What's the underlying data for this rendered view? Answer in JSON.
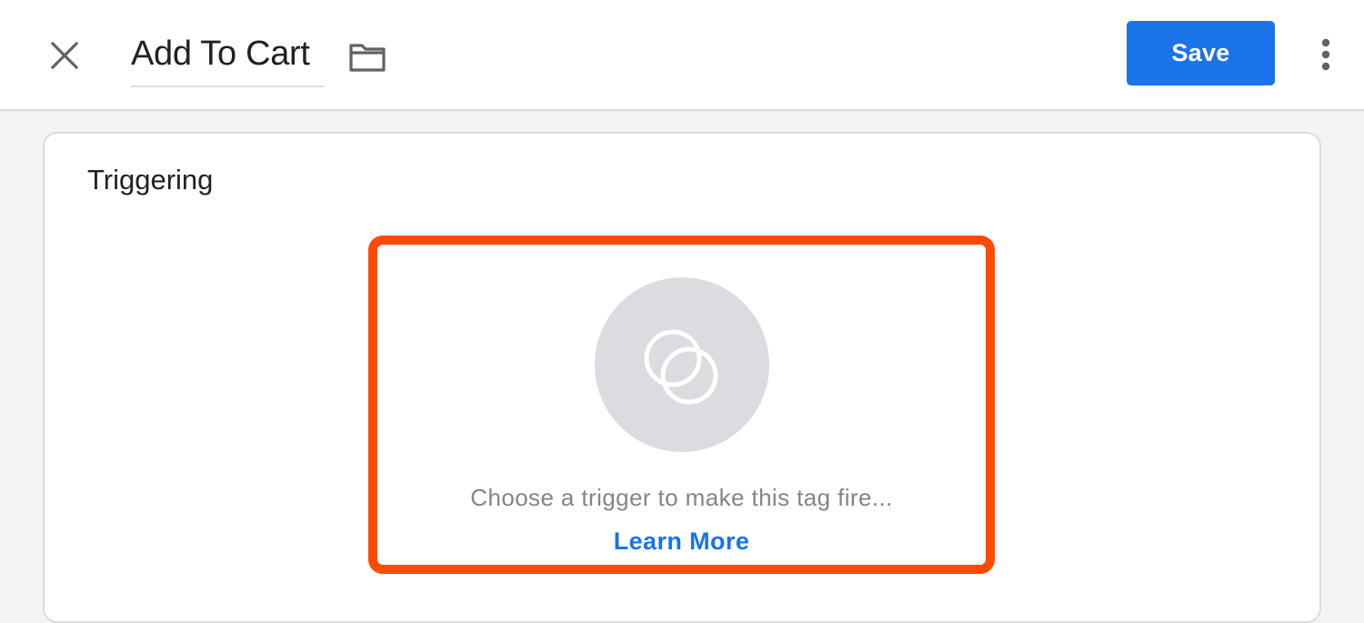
{
  "header": {
    "close_icon": "close-icon",
    "title": "Add To Cart",
    "folder_icon": "folder-icon",
    "save_label": "Save",
    "more_icon": "more-vert-icon"
  },
  "triggering": {
    "section_title": "Triggering",
    "icon": "trigger-circles-icon",
    "prompt": "Choose a trigger to make this tag fire...",
    "learn_more": "Learn More"
  },
  "colors": {
    "accent": "#1a73e8",
    "highlight": "#ff4a00",
    "background": "#f1f3f4",
    "icon_circle": "#dadce0"
  }
}
